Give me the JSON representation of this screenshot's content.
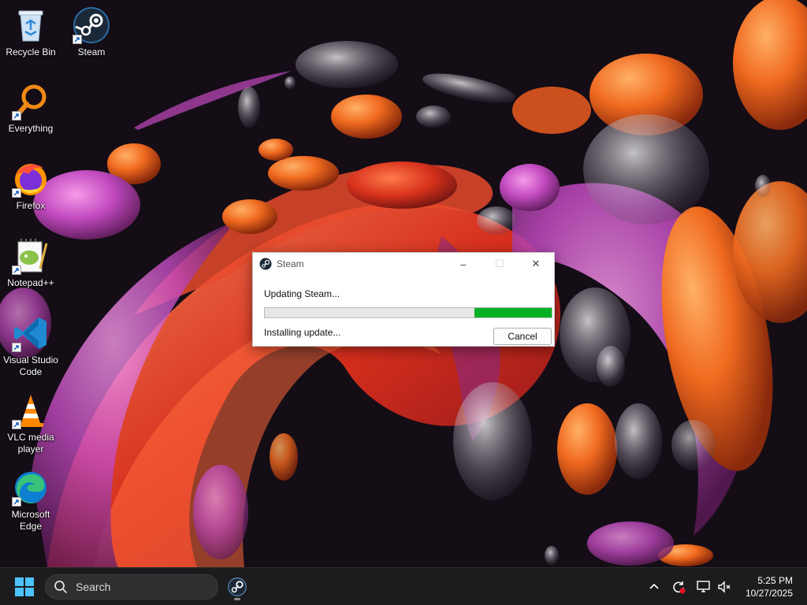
{
  "desktop": {
    "icons": [
      {
        "id": "recycle-bin",
        "label": "Recycle Bin",
        "icon": "recycle-bin-icon"
      },
      {
        "id": "steam",
        "label": "Steam",
        "icon": "steam-icon"
      },
      {
        "id": "everything",
        "label": "Everything",
        "icon": "magnifier-icon"
      },
      {
        "id": "firefox",
        "label": "Firefox",
        "icon": "firefox-icon"
      },
      {
        "id": "notepadpp",
        "label": "Notepad++",
        "icon": "notepadpp-icon"
      },
      {
        "id": "vscode",
        "label": "Visual Studio Code",
        "icon": "vscode-icon"
      },
      {
        "id": "vlc",
        "label": "VLC media player",
        "icon": "vlc-cone-icon"
      },
      {
        "id": "edge",
        "label": "Microsoft Edge",
        "icon": "edge-icon"
      }
    ]
  },
  "dialog": {
    "title": "Steam",
    "status": "Updating Steam...",
    "substatus": "Installing update...",
    "progress": {
      "start_fraction": 0.73,
      "end_fraction": 1.0
    },
    "cancel_label": "Cancel",
    "minimize_glyph": "–",
    "maximize_glyph": "☐",
    "close_glyph": "✕"
  },
  "taskbar": {
    "search_placeholder": "Search",
    "pinned": [
      {
        "label": "Steam",
        "icon": "steam-icon"
      }
    ],
    "tray": [
      {
        "icon": "chevron-up-icon"
      },
      {
        "icon": "update-sync-icon"
      },
      {
        "icon": "network-icon"
      },
      {
        "icon": "volume-muted-icon"
      }
    ],
    "clock": {
      "time": "5:25 PM",
      "date": "10/27/2025"
    }
  },
  "colors": {
    "accent_green": "#06b025",
    "taskbar": "#1c1c1e",
    "windows_blue": "#4cc2ff"
  }
}
